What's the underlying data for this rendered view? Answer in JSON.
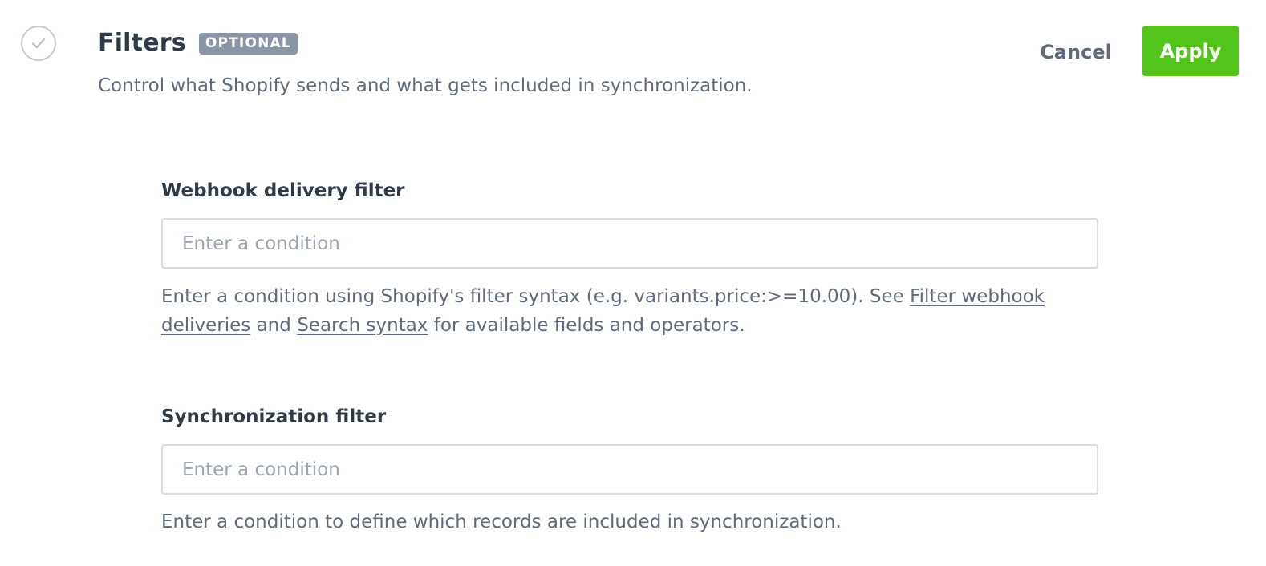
{
  "header": {
    "title": "Filters",
    "badge": "OPTIONAL",
    "subtitle": "Control what Shopify sends and what gets included in synchronization."
  },
  "actions": {
    "cancel_label": "Cancel",
    "apply_label": "Apply"
  },
  "webhook_filter": {
    "label": "Webhook delivery filter",
    "value": "",
    "placeholder": "Enter a condition",
    "help_prefix": "Enter a condition using Shopify's filter syntax (e.g. variants.price:>=10.00). See ",
    "help_link1": "Filter webhook deliveries",
    "help_middle": " and ",
    "help_link2": "Search syntax",
    "help_suffix": " for available fields and operators."
  },
  "sync_filter": {
    "label": "Synchronization filter",
    "value": "",
    "placeholder": "Enter a condition",
    "help": "Enter a condition to define which records are included in synchronization."
  },
  "icons": {
    "step": "check-circle-icon"
  },
  "colors": {
    "apply": "#52c41a",
    "badge": "#8a96a3",
    "title": "#2f3a48",
    "text": "#5f6b7a"
  }
}
